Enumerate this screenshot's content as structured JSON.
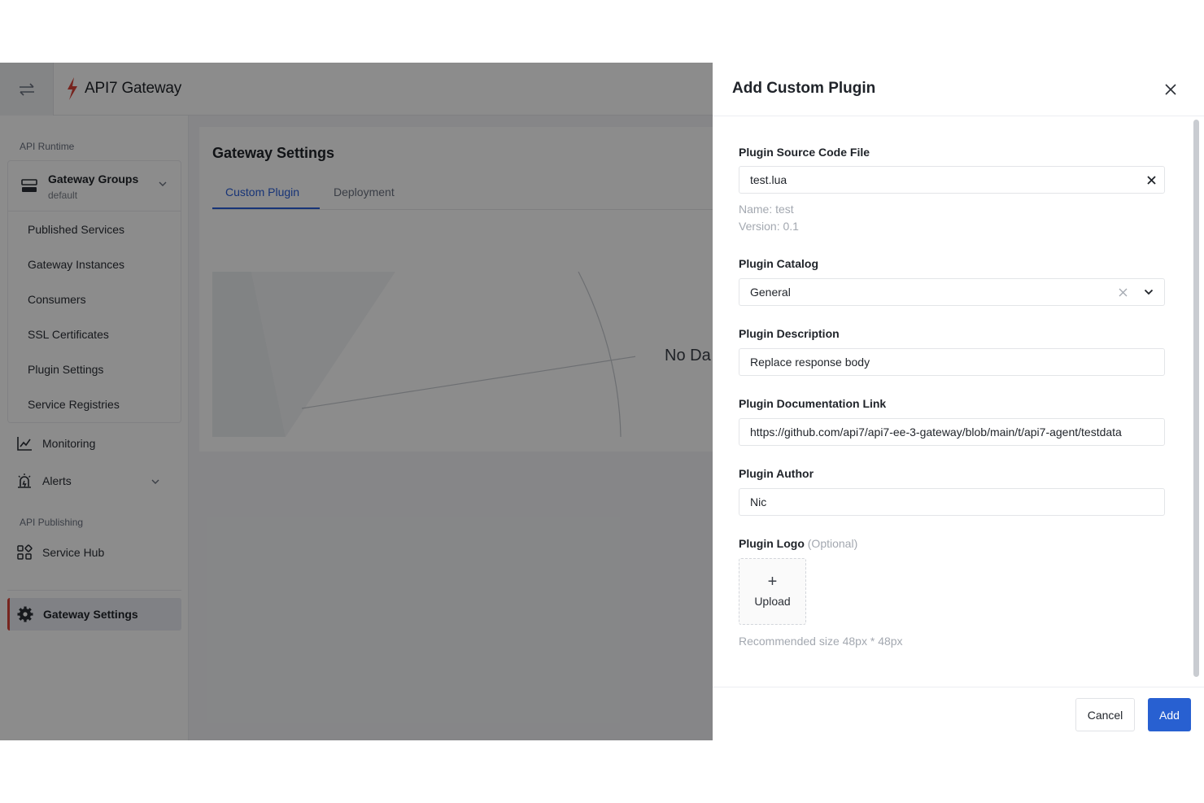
{
  "app": {
    "logo_text": "API7 Gateway",
    "brand_color": "#d94338",
    "accent_color": "#2b5fd9"
  },
  "sidebar": {
    "runtime_label": "API Runtime",
    "group": {
      "title": "Gateway Groups",
      "subtitle": "default"
    },
    "group_items": [
      {
        "label": "Published Services"
      },
      {
        "label": "Gateway Instances"
      },
      {
        "label": "Consumers"
      },
      {
        "label": "SSL Certificates"
      },
      {
        "label": "Plugin Settings"
      },
      {
        "label": "Service Registries"
      }
    ],
    "monitoring_label": "Monitoring",
    "alerts_label": "Alerts",
    "publishing_label": "API Publishing",
    "service_hub_label": "Service Hub",
    "active_label": "Gateway Settings"
  },
  "content": {
    "title": "Gateway Settings",
    "tabs": [
      {
        "label": "Custom Plugin",
        "active": true
      },
      {
        "label": "Deployment",
        "active": false
      }
    ],
    "empty_text": "No Da"
  },
  "drawer": {
    "title": "Add Custom Plugin",
    "source_file": {
      "label": "Plugin Source Code File",
      "value": "test.lua",
      "name_hint": "Name: test",
      "version_hint": "Version: 0.1"
    },
    "catalog": {
      "label": "Plugin Catalog",
      "value": "General"
    },
    "description": {
      "label": "Plugin Description",
      "value": "Replace response body"
    },
    "doc_link": {
      "label": "Plugin Documentation Link",
      "value": "https://github.com/api7/api7-ee-3-gateway/blob/main/t/api7-agent/testdata"
    },
    "author": {
      "label": "Plugin Author",
      "value": "Nic"
    },
    "logo": {
      "label": "Plugin Logo",
      "optional": "(Optional)",
      "upload_label": "Upload",
      "hint": "Recommended size 48px * 48px"
    },
    "cancel_label": "Cancel",
    "add_label": "Add"
  }
}
